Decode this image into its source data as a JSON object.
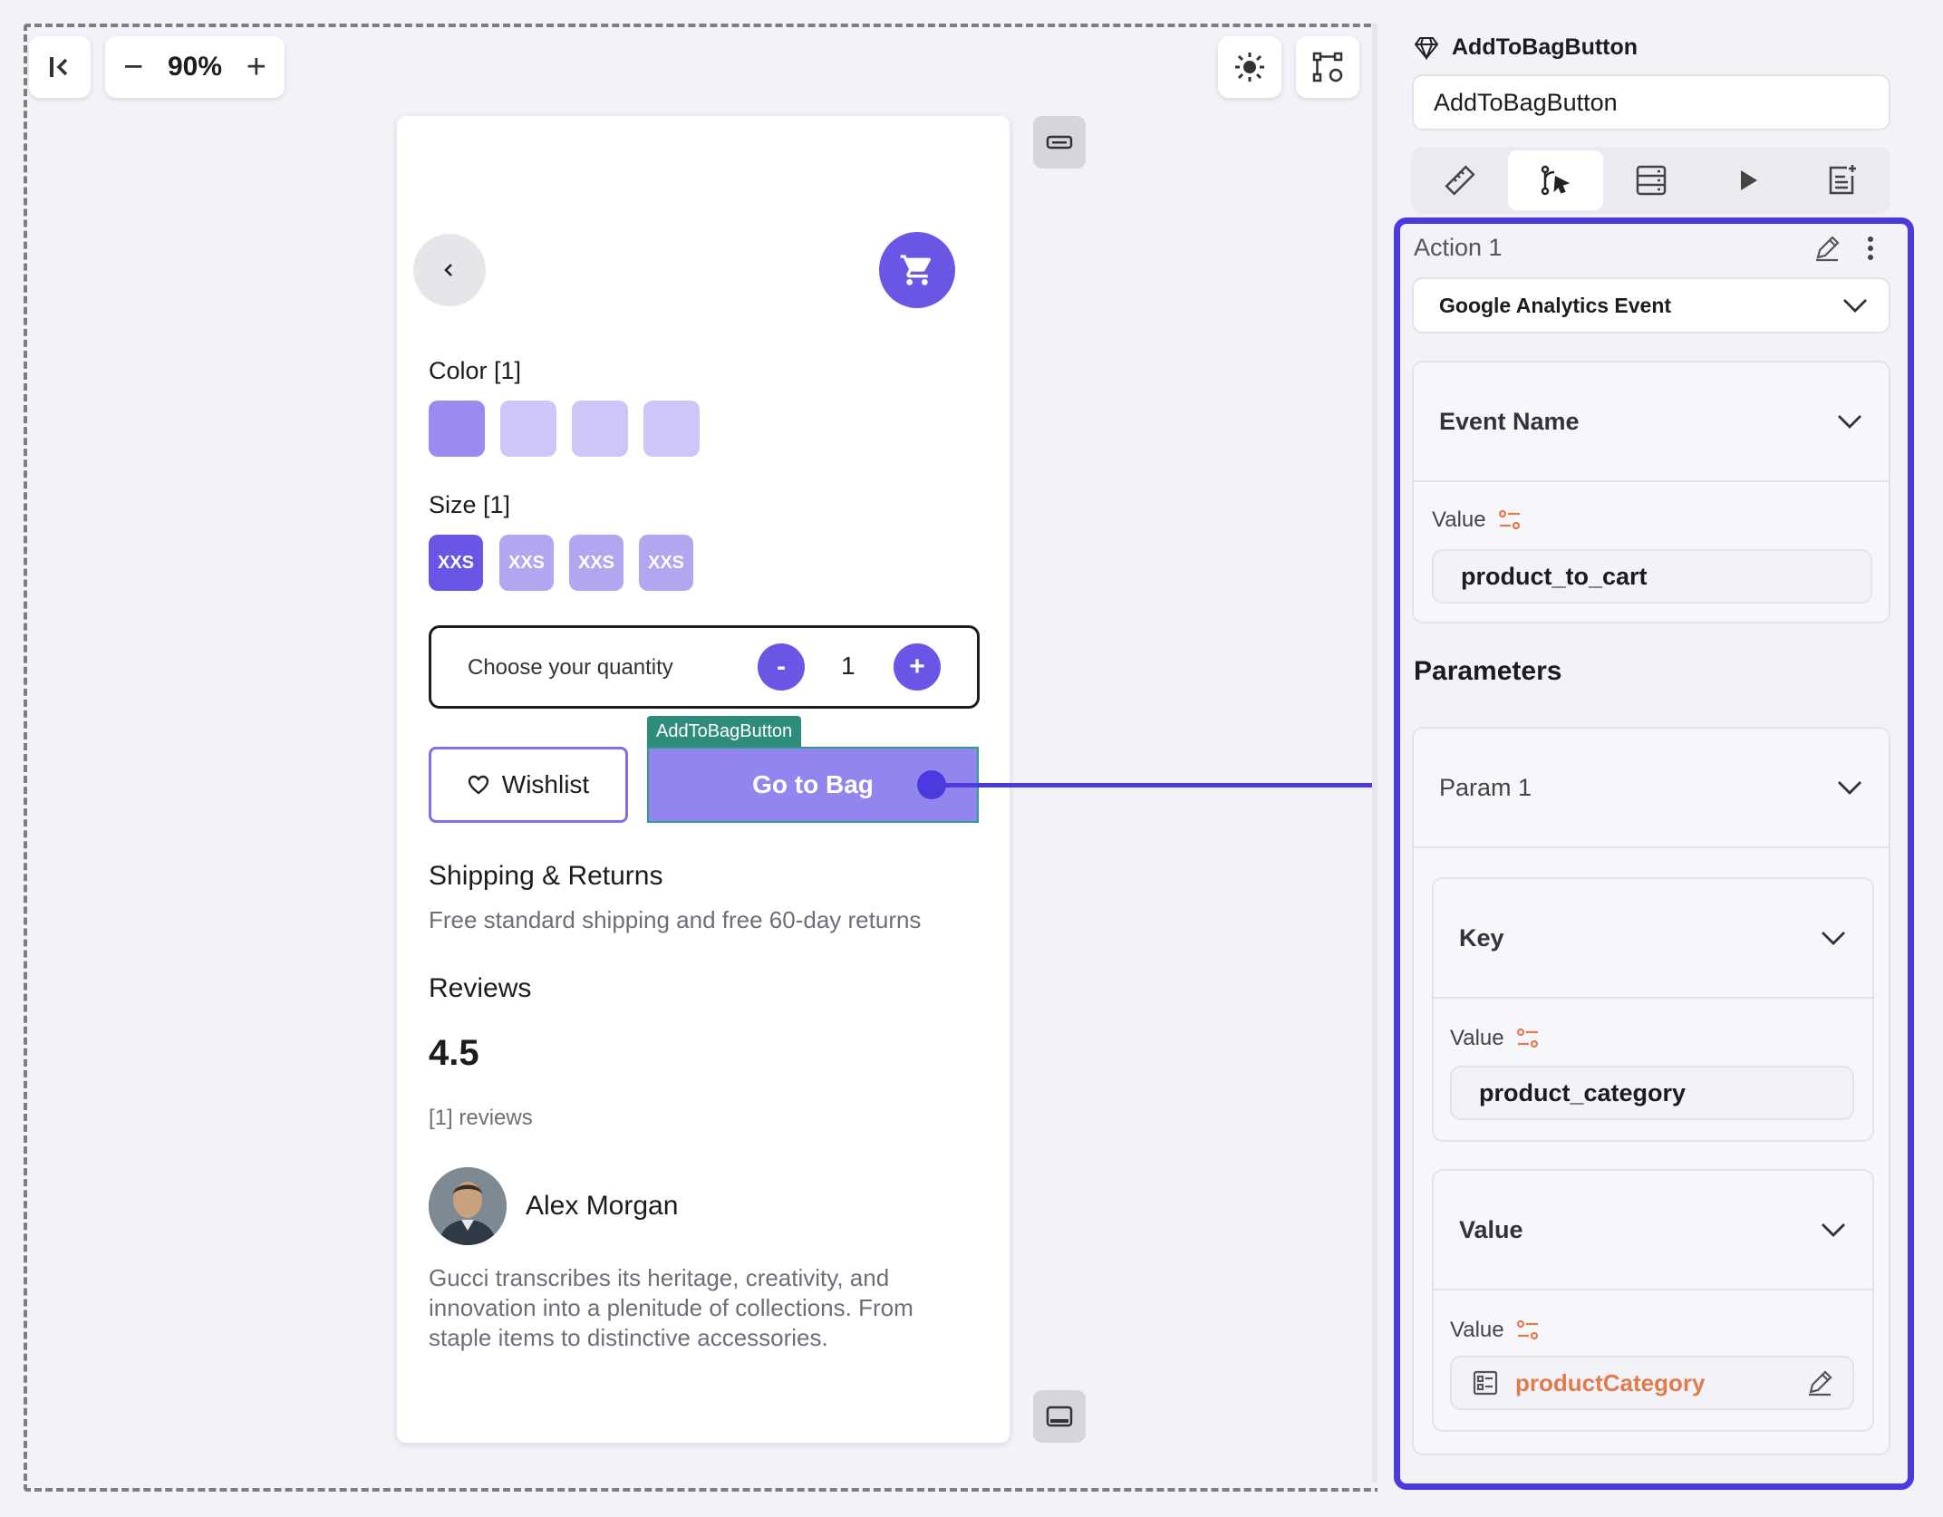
{
  "toolbar": {
    "zoom_minus": "−",
    "zoom_value": "90%",
    "zoom_plus": "+"
  },
  "phone": {
    "color_label": "Color [1]",
    "size_label": "Size  [1]",
    "sizes": [
      "XXS",
      "XXS",
      "XXS",
      "XXS"
    ],
    "quantity_label": "Choose your quantity",
    "qty_minus": "-",
    "qty_value": "1",
    "qty_plus": "+",
    "selection_tag": "AddToBagButton",
    "wishlist_label": "Wishlist",
    "gotobag_label": "Go to Bag",
    "shipping_title": "Shipping & Returns",
    "shipping_text": "Free standard shipping and free 60-day returns",
    "reviews_title": "Reviews",
    "rating": "4.5",
    "reviews_count": "[1] reviews",
    "reviewer_name": "Alex Morgan",
    "review_text": "Gucci transcribes its heritage, creativity, and innovation into a plenitude of collections. From staple items to distinctive accessories.",
    "colors": {
      "accent": "#6a56e4",
      "swatch_selected": "#9a8cef",
      "swatch": "#cdc6f7"
    }
  },
  "panel": {
    "widget_title": "AddToBagButton",
    "widget_name_value": "AddToBagButton",
    "tabs": [
      "ruler-pencil-icon",
      "action-flow-icon",
      "database-icon",
      "play-icon",
      "notes-plus-icon"
    ],
    "action_title": "Action 1",
    "action_type": "Google Analytics Event",
    "event_name_label": "Event Name",
    "value_label": "Value",
    "event_name_value": "product_to_cart",
    "parameters_title": "Parameters",
    "param_title": "Param 1",
    "key_label": "Key",
    "key_value_label": "Value",
    "key_value": "product_category",
    "value_section_label": "Value",
    "value_value_label": "Value",
    "value_variable": "productCategory",
    "colors": {
      "highlight": "#4a3ae0",
      "variable": "#e07b4a"
    }
  }
}
